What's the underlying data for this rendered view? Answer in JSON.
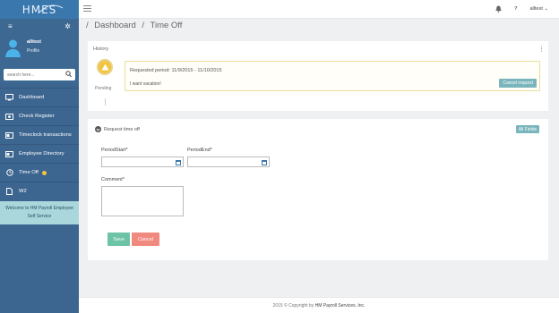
{
  "brand": {
    "logo_text": "HMES"
  },
  "sidebar": {
    "user": {
      "name": "alltest",
      "role": "Profile"
    },
    "search": {
      "placeholder": "search here..."
    },
    "items": [
      {
        "label": "Dashboard",
        "icon": "monitor-icon"
      },
      {
        "label": "Check Register",
        "icon": "money-icon"
      },
      {
        "label": "Timeclock transactions",
        "icon": "card-icon"
      },
      {
        "label": "Employee Directory",
        "icon": "card-icon"
      },
      {
        "label": "Time Off",
        "icon": "clock-icon"
      },
      {
        "label": "W2",
        "icon": "document-icon"
      }
    ],
    "welcome": "Welcome to HM Payroll Employee Self Service"
  },
  "topbar": {
    "user": "alltest",
    "help": "?"
  },
  "breadcrumb": {
    "sep": "/",
    "dashboard": "Dashboard",
    "current": "Time Off"
  },
  "history": {
    "title": "History",
    "status": "Pending",
    "requested_period": "Requested period: 11/9/2015 - 11/10/2015",
    "note": "I want vacation!",
    "cancel_request": "Cancel request"
  },
  "form": {
    "title": "Request time off",
    "all_fields": "All Fields",
    "period_start_label": "PeriodStart*",
    "period_end_label": "PeriodEnd*",
    "comment_label": "Comment*",
    "save": "Save",
    "cancel": "Cancel"
  },
  "footer": {
    "prefix": "2015 © Copyright by",
    "company": "HM Payroll Services, Inc."
  },
  "colors": {
    "sidebar": "#3c6590",
    "welcome": "#a9d7dc",
    "save": "#6cc3a6",
    "cancel": "#f08a7f",
    "teal_button": "#7ab5bd"
  }
}
